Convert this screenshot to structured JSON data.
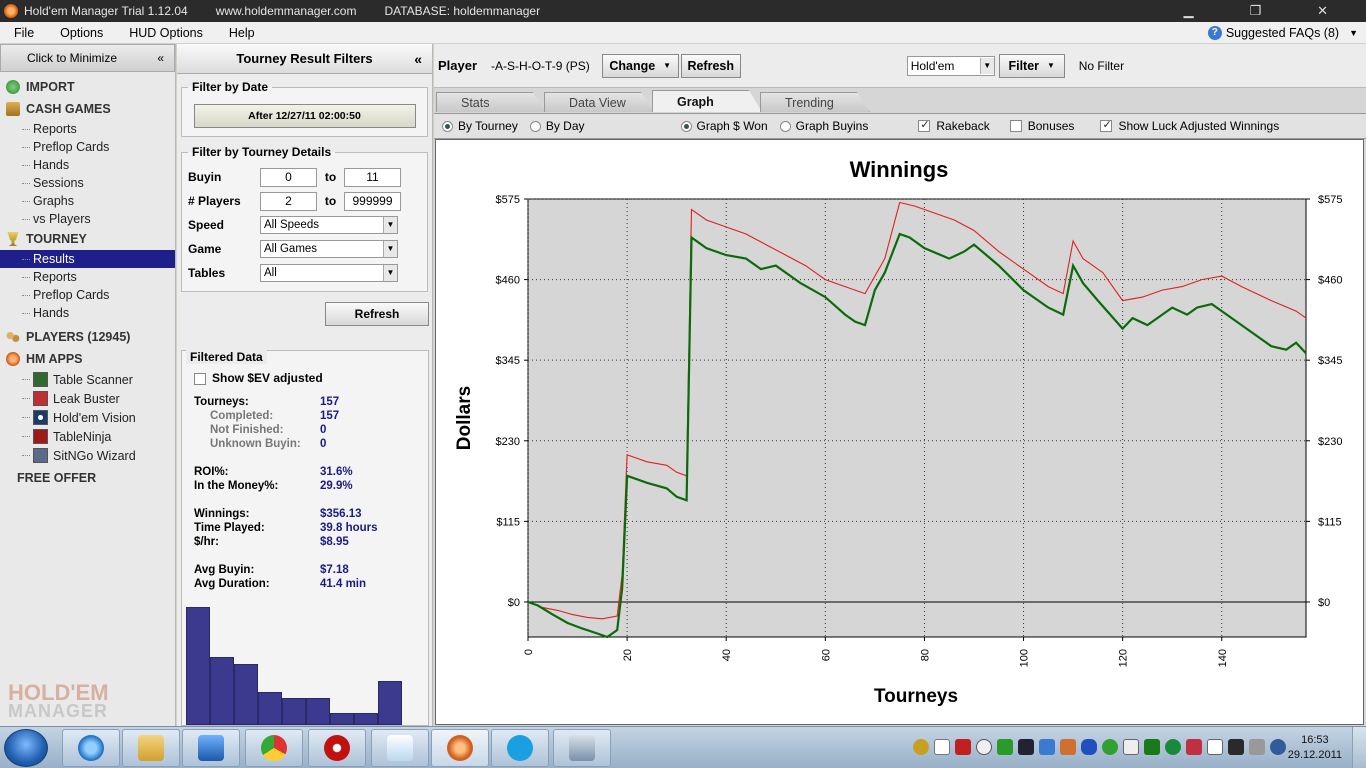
{
  "window": {
    "title": "Hold'em Manager Trial 1.12.04",
    "site": "www.holdemmanager.com",
    "database": "DATABASE: holdemmanager"
  },
  "menu": {
    "items": [
      "File",
      "Options",
      "HUD Options",
      "Help"
    ],
    "faq": "Suggested FAQs (8)"
  },
  "leftnav": {
    "minimize": "Click to Minimize",
    "import": "IMPORT",
    "cash_games": "CASH GAMES",
    "cash_items": [
      "Reports",
      "Preflop Cards",
      "Hands",
      "Sessions",
      "Graphs",
      "vs Players"
    ],
    "tourney": "TOURNEY",
    "tourney_items": [
      "Results",
      "Reports",
      "Preflop Cards",
      "Hands"
    ],
    "players": "PLAYERS (12945)",
    "hm_apps": "HM APPS",
    "apps": [
      "Table Scanner",
      "Leak Buster",
      "Hold'em Vision",
      "TableNinja",
      "SitNGo Wizard"
    ],
    "free_offer": "FREE OFFER",
    "logo_top": "HOLD'EM",
    "logo_bottom": "MANAGER"
  },
  "filters": {
    "title": "Tourney Result Filters",
    "by_date_legend": "Filter by Date",
    "date_button": "After 12/27/11 02:00:50",
    "details_legend": "Filter by Tourney Details",
    "buyin_label": "Buyin",
    "buyin_min": "0",
    "buyin_max": "11",
    "players_label": "# Players",
    "players_min": "2",
    "players_max": "999999",
    "to": "to",
    "speed_label": "Speed",
    "speed_value": "All Speeds",
    "game_label": "Game",
    "game_value": "All Games",
    "tables_label": "Tables",
    "tables_value": "All",
    "refresh": "Refresh"
  },
  "filtered_data": {
    "legend": "Filtered Data",
    "show_ev": "Show $EV adjusted",
    "tourneys_label": "Tourneys:",
    "tourneys": "157",
    "completed_label": "Completed:",
    "completed": "157",
    "not_finished_label": "Not Finished:",
    "not_finished": "0",
    "unknown_label": "Unknown Buyin:",
    "unknown": "0",
    "roi_label": "ROI%:",
    "roi": "31.6%",
    "itm_label": "In the Money%:",
    "itm": "29.9%",
    "winnings_label": "Winnings:",
    "winnings": "$356.13",
    "time_label": "Time Played:",
    "time": "39.8 hours",
    "hr_label": "$/hr:",
    "hr": "$8.95",
    "avg_buyin_label": "Avg Buyin:",
    "avg_buyin": "$7.18",
    "avg_dur_label": "Avg Duration:",
    "avg_dur": "41.4 min",
    "histogram": [
      100,
      58,
      52,
      28,
      23,
      23,
      10,
      10,
      37
    ]
  },
  "main": {
    "player_label": "Player",
    "player_name": "-A-S-H-O-T-9 (PS)",
    "change": "Change",
    "refresh": "Refresh",
    "game_select": "Hold'em",
    "filter": "Filter",
    "no_filter": "No Filter",
    "tabs": [
      "Stats",
      "Data View",
      "Graph",
      "Trending"
    ],
    "options": {
      "by_tourney": "By Tourney",
      "by_day": "By Day",
      "graph_won": "Graph $ Won",
      "graph_buyins": "Graph Buyins",
      "rakeback": "Rakeback",
      "bonuses": "Bonuses",
      "luck": "Show Luck Adjusted Winnings"
    }
  },
  "taskbar": {
    "time": "16:53",
    "date": "29.12.2011"
  },
  "colors": {
    "winnings_line": "#0b6b0b",
    "luck_line": "#e02020",
    "nav_selected": "#1f1f8c",
    "stat_value": "#1a1a8a"
  },
  "chart_data": {
    "type": "line",
    "title": "Winnings",
    "xlabel": "Tourneys",
    "ylabel": "Dollars",
    "xlim": [
      0,
      157
    ],
    "ylim": [
      -50,
      575
    ],
    "yticks": [
      0,
      115,
      230,
      345,
      460,
      575
    ],
    "ytick_labels": [
      "$0",
      "$115",
      "$230",
      "$345",
      "$460",
      "$575"
    ],
    "xticks": [
      0,
      20,
      40,
      60,
      80,
      100,
      120,
      140
    ],
    "grid": true,
    "series": [
      {
        "color": "#0b6b0b",
        "x": [
          0,
          2,
          5,
          8,
          11,
          14,
          16,
          18,
          19,
          20,
          24,
          28,
          30,
          32,
          33,
          36,
          40,
          44,
          47,
          50,
          55,
          60,
          64,
          66,
          68,
          70,
          72,
          75,
          77,
          80,
          85,
          88,
          90,
          95,
          100,
          105,
          108,
          110,
          112,
          115,
          120,
          122,
          125,
          128,
          130,
          133,
          135,
          138,
          140,
          145,
          150,
          153,
          155,
          157
        ],
        "y": [
          0,
          -5,
          -18,
          -30,
          -38,
          -45,
          -50,
          -40,
          20,
          180,
          170,
          162,
          150,
          145,
          520,
          505,
          495,
          490,
          475,
          480,
          455,
          435,
          410,
          400,
          395,
          445,
          470,
          525,
          520,
          505,
          490,
          500,
          510,
          480,
          445,
          420,
          410,
          480,
          455,
          430,
          390,
          405,
          395,
          410,
          420,
          410,
          420,
          425,
          415,
          390,
          365,
          360,
          370,
          355
        ]
      },
      {
        "color": "#e02020",
        "x": [
          0,
          3,
          6,
          9,
          12,
          15,
          18,
          19,
          20,
          24,
          28,
          30,
          32,
          33,
          36,
          40,
          44,
          48,
          52,
          56,
          60,
          64,
          68,
          70,
          72,
          75,
          78,
          82,
          86,
          90,
          95,
          100,
          105,
          108,
          110,
          112,
          116,
          120,
          124,
          128,
          132,
          136,
          140,
          144,
          150,
          155,
          157
        ],
        "y": [
          0,
          -8,
          -12,
          -18,
          -22,
          -24,
          -20,
          40,
          210,
          200,
          195,
          185,
          180,
          560,
          545,
          535,
          525,
          510,
          495,
          480,
          460,
          450,
          440,
          465,
          490,
          570,
          565,
          555,
          545,
          530,
          500,
          475,
          450,
          440,
          515,
          490,
          470,
          430,
          435,
          445,
          450,
          460,
          465,
          450,
          430,
          415,
          405
        ]
      }
    ]
  }
}
